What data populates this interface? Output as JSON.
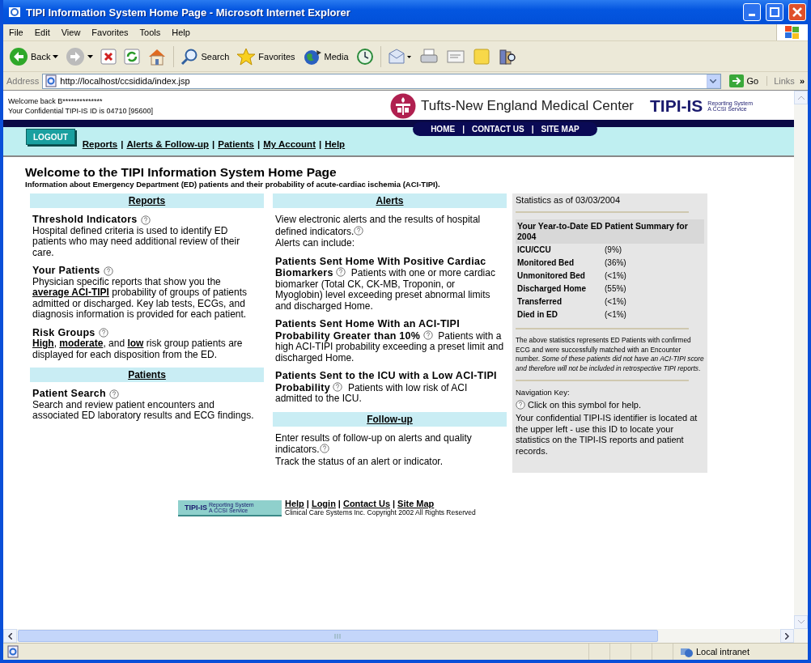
{
  "window": {
    "title": "TIPI Information System Home Page - Microsoft Internet Explorer"
  },
  "menu": [
    "File",
    "Edit",
    "View",
    "Favorites",
    "Tools",
    "Help"
  ],
  "toolbar": [
    {
      "kind": "back",
      "label": "Back"
    },
    {
      "kind": "forward"
    },
    {
      "kind": "stop"
    },
    {
      "kind": "refresh"
    },
    {
      "kind": "home"
    },
    {
      "kind": "search",
      "label": "Search"
    },
    {
      "kind": "favorites",
      "label": "Favorites"
    },
    {
      "kind": "media",
      "label": "Media"
    },
    {
      "kind": "history"
    },
    {
      "kind": "mail"
    },
    {
      "kind": "print"
    },
    {
      "kind": "edit"
    },
    {
      "kind": "discuss"
    },
    {
      "kind": "research"
    }
  ],
  "address": {
    "label": "Address",
    "value": "http://localhost/ccsidida/index.jsp",
    "go": "Go",
    "links": "Links",
    "chevron": "»"
  },
  "header": {
    "welcome": "Welcome back B**************",
    "id_line": "Your Confidential TIPI-IS ID is 04710 [95600]",
    "org": "Tufts-New England Medical Center",
    "brand": "TIPI-IS",
    "brand_sub": [
      "Reporting System",
      "A CCSI Service"
    ]
  },
  "nav": {
    "logout": "LOGOUT",
    "links": [
      "Reports",
      "Alerts & Follow-up",
      "Patients",
      "My Account",
      "Help"
    ],
    "separator": "|",
    "top_links": [
      "HOME",
      "CONTACT US",
      "SITE MAP"
    ]
  },
  "page": {
    "title": "Welcome to the TIPI Information System Home Page",
    "subtitle": "Information about Emergency Department (ED) patients and their probability of acute-cardiac ischemia (ACI-TIPI)."
  },
  "columns": [
    [
      {
        "heading": "Reports",
        "blocks": [
          {
            "kind": "entry",
            "title": "Threshold Indicators",
            "help": true,
            "parts": [
              {
                "text": "Hospital defined criteria is used to identify ED patients who may need additional review of their care."
              }
            ]
          },
          {
            "kind": "entry",
            "title": "Your Patients",
            "help": true,
            "parts": [
              {
                "text": "Physician specific reports that show you the "
              },
              {
                "text": "average ACI-TIPI",
                "kind": "link"
              },
              {
                "text": " probability of groups of patients admitted or discharged. Key lab tests, ECGs, and diagnosis information is provided for each patient."
              }
            ]
          },
          {
            "kind": "entry",
            "title": "Risk Groups",
            "help": true,
            "parts": [
              {
                "text": "High",
                "kind": "link"
              },
              {
                "text": ", "
              },
              {
                "text": "moderate",
                "kind": "link"
              },
              {
                "text": ", and "
              },
              {
                "text": "low",
                "kind": "link"
              },
              {
                "text": " risk group patients are displayed for each disposition from the ED."
              }
            ]
          }
        ]
      },
      {
        "heading": "Patients",
        "blocks": [
          {
            "kind": "entry",
            "title": "Patient Search",
            "help": true,
            "parts": [
              {
                "text": "Search and review patient encounters and associated ED laboratory results and ECG findings."
              }
            ]
          }
        ]
      }
    ],
    [
      {
        "heading": "Alerts",
        "blocks": [
          {
            "kind": "text",
            "help": true,
            "parts": [
              {
                "text": "View electronic alerts and the results of hospital defined indicators."
              }
            ]
          },
          {
            "kind": "caption",
            "help": false,
            "parts": [
              {
                "text": "Alerts can include:"
              }
            ]
          },
          {
            "kind": "inline",
            "title": "Patients Sent Home With Positive Cardiac Biomarkers",
            "help": true,
            "parts": [
              {
                "text": "Patients with one or more cardiac biomarker (Total CK, CK-MB, Troponin, or Myoglobin) level exceeding preset abnormal limits and discharged Home."
              }
            ]
          },
          {
            "kind": "inline",
            "title": "Patients Sent Home With an ACI-TIPI Probability Greater than 10%",
            "help": true,
            "parts": [
              {
                "text": "Patients with a high ACI-TIPI probability exceeding a preset limit and discharged Home."
              }
            ]
          },
          {
            "kind": "inline",
            "title": "Patients Sent to the ICU with a Low ACI-TIPI Probability",
            "help": true,
            "parts": [
              {
                "text": "Patients with low risk of ACI admitted to the ICU."
              }
            ]
          }
        ]
      },
      {
        "heading": "Follow-up",
        "blocks": [
          {
            "kind": "text",
            "help": true,
            "parts": [
              {
                "text": "Enter results of follow-up on alerts and quality indicators."
              }
            ]
          },
          {
            "kind": "text",
            "help": false,
            "parts": [
              {
                "text": "Track the status of an alert or indicator."
              }
            ]
          }
        ]
      }
    ]
  ],
  "stats_panel": {
    "date": "Statistics as of 03/03/2004",
    "summary_title": "Your Year-to-Date ED Patient Summary for 2004",
    "stats": [
      {
        "label": "ICU/CCU",
        "value": "(9%)"
      },
      {
        "label": "Monitored Bed",
        "value": "(36%)"
      },
      {
        "label": "Unmonitored Bed",
        "value": "(<1%)"
      },
      {
        "label": "Discharged Home",
        "value": "(55%)"
      },
      {
        "label": "Transferred",
        "value": "(<1%)"
      },
      {
        "label": "Died in ED",
        "value": "(<1%)"
      }
    ],
    "note": "The above statistics represents ED Patients with confirmed ECG and were successfully matched with an Encounter number. *Some of these patients did not have an ACI-TIPI score and therefore will not be included in retrospective TIPI reports*.",
    "key_title": "Navigation Key:",
    "key_help": "Click on this symbol for help.",
    "key_text": "Your confidential TIPI-IS identifier is located at the upper left - use this ID to locate your statistics on the TIPI-IS reports and patient records."
  },
  "footer": {
    "links": [
      "Help",
      "Login",
      "Contact Us",
      "Site Map"
    ],
    "separator": "|",
    "brand": "TIPI-IS",
    "brand_sub": [
      "Reporting System",
      "A CCSI Service"
    ],
    "copyright": "Clinical Care Systems Inc. Copyright 2002 All Rights Reserved"
  },
  "status_bar": {
    "zone": "Local intranet"
  }
}
